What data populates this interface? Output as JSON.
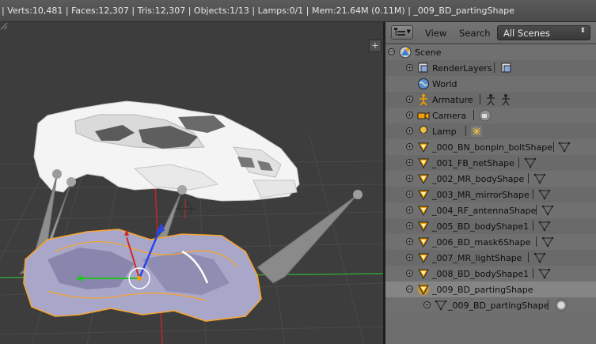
{
  "header": {
    "stats": "| Verts:10,481 | Faces:12,307 | Tris:12,307 | Objects:1/13 | Lamps:0/1 | Mem:21.64M (0.11M) | _009_BD_partingShape"
  },
  "viewport": {
    "add_glyph": "+"
  },
  "outliner": {
    "view_menu": "View",
    "search_menu": "Search",
    "display_mode": "All Scenes",
    "rows": [
      {
        "label": "Scene"
      },
      {
        "label": "RenderLayers"
      },
      {
        "label": "World"
      },
      {
        "label": "Armature"
      },
      {
        "label": "Camera"
      },
      {
        "label": "Lamp"
      },
      {
        "label": "_000_BN_bonpin_boltShape"
      },
      {
        "label": "_001_FB_netShape"
      },
      {
        "label": "_002_MR_bodyShape"
      },
      {
        "label": "_003_MR_mirrorShape"
      },
      {
        "label": "_004_RF_antennaShape"
      },
      {
        "label": "_005_BD_bodyShape1"
      },
      {
        "label": "_006_BD_mask6Shape"
      },
      {
        "label": "_007_MR_lightShape"
      },
      {
        "label": "_008_BD_bodyShape1"
      },
      {
        "label": "_009_BD_partingShape"
      },
      {
        "label": "_009_BD_partingShape"
      }
    ]
  },
  "colors": {
    "selected_row": "#858585",
    "mesh_orange": "#f0a000",
    "selection_outline": "#f5a530",
    "x_axis": "#d03030",
    "y_axis": "#30c030",
    "z_axis": "#3050e0"
  },
  "icons": {
    "scene": "scene-icon",
    "render_layers": "render-layers-icon",
    "world": "world-icon",
    "armature": "armature-icon",
    "camera": "camera-icon",
    "lamp": "lamp-icon",
    "mesh": "mesh-triangle-icon",
    "mesh_data": "mesh-data-icon",
    "material": "material-icon"
  }
}
